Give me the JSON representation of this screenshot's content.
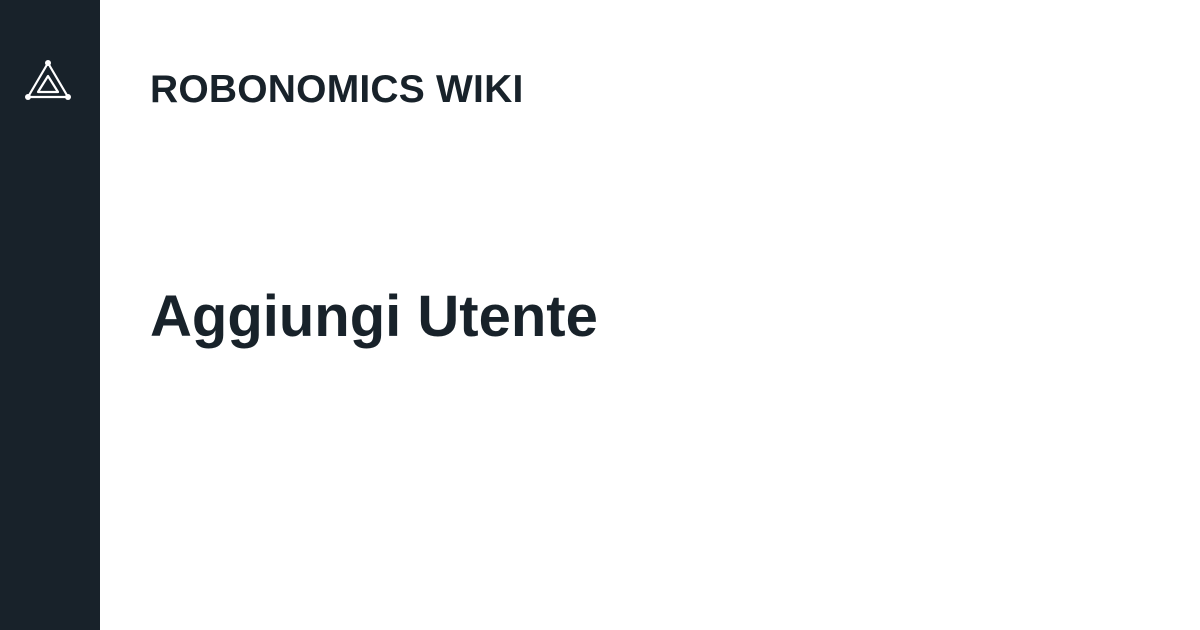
{
  "brand": {
    "logo_icon": "robonomics-triangle-logo-icon",
    "sidebar_color": "#18222a",
    "text_color": "#18222a"
  },
  "header": {
    "site_title": "ROBONOMICS WIKI"
  },
  "main": {
    "page_title": "Aggiungi Utente"
  }
}
